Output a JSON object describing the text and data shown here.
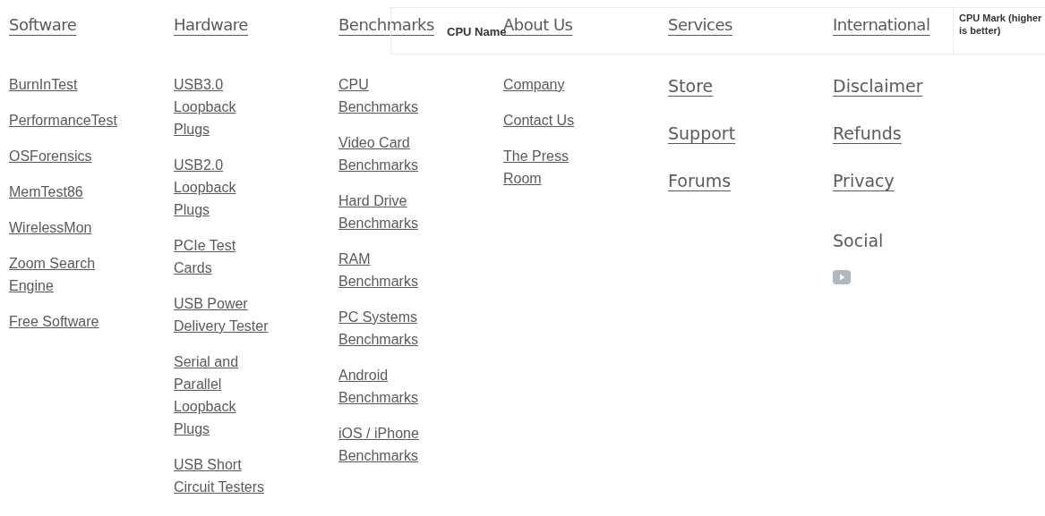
{
  "footer_columns": [
    {
      "heading": "Software",
      "items": [
        {
          "label": "BurnInTest",
          "kind": "link"
        },
        {
          "label": "PerformanceTest",
          "kind": "link"
        },
        {
          "label": "OSForensics",
          "kind": "link"
        },
        {
          "label": "MemTest86",
          "kind": "link"
        },
        {
          "label": "WirelessMon",
          "kind": "link"
        },
        {
          "label": "Zoom Search Engine",
          "kind": "link"
        },
        {
          "label": "Free Software",
          "kind": "link"
        }
      ]
    },
    {
      "heading": "Hardware",
      "items": [
        {
          "label": "USB3.0 Loopback Plugs",
          "kind": "link"
        },
        {
          "label": "USB2.0 Loopback Plugs",
          "kind": "link"
        },
        {
          "label": "PCIe Test Cards",
          "kind": "link"
        },
        {
          "label": "USB Power Delivery Tester",
          "kind": "link"
        },
        {
          "label": "Serial and Parallel Loopback Plugs",
          "kind": "link"
        },
        {
          "label": "USB Short Circuit Testers",
          "kind": "link"
        }
      ]
    },
    {
      "heading": "Benchmarks",
      "items": [
        {
          "label": "CPU Benchmarks",
          "kind": "link"
        },
        {
          "label": "Video Card Benchmarks",
          "kind": "link"
        },
        {
          "label": "Hard Drive Benchmarks",
          "kind": "link"
        },
        {
          "label": "RAM Benchmarks",
          "kind": "link"
        },
        {
          "label": "PC Systems Benchmarks",
          "kind": "link"
        },
        {
          "label": "Android Benchmarks",
          "kind": "link"
        },
        {
          "label": "iOS / iPhone Benchmarks",
          "kind": "link"
        }
      ]
    },
    {
      "heading": "About Us",
      "items": [
        {
          "label": "Company",
          "kind": "link"
        },
        {
          "label": "Contact Us",
          "kind": "link"
        },
        {
          "label": "The Press Room",
          "kind": "link"
        }
      ]
    },
    {
      "heading": "Services",
      "items": [
        {
          "label": "Store",
          "kind": "section-link"
        },
        {
          "label": "Support",
          "kind": "section-link"
        },
        {
          "label": "Forums",
          "kind": "section-link"
        }
      ]
    },
    {
      "heading": "International",
      "items": [
        {
          "label": "Disclaimer",
          "kind": "section-link"
        },
        {
          "label": "Refunds",
          "kind": "section-link"
        },
        {
          "label": "Privacy",
          "kind": "section-link"
        },
        {
          "label": "Social",
          "kind": "social"
        }
      ]
    }
  ],
  "table_header": {
    "columns": [
      "CPU Name",
      "CPU Mark (higher is better)"
    ]
  }
}
